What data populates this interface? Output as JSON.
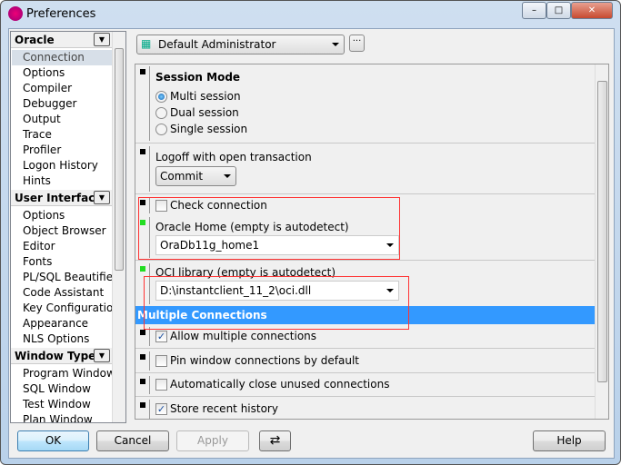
{
  "window": {
    "title": "Preferences",
    "minimize": "–",
    "maximize": "□",
    "close": "✕"
  },
  "sidebar": {
    "groups": [
      {
        "label": "Oracle",
        "items": [
          "Connection",
          "Options",
          "Compiler",
          "Debugger",
          "Output",
          "Trace",
          "Profiler",
          "Logon History",
          "Hints"
        ]
      },
      {
        "label": "User Interface",
        "items": [
          "Options",
          "Object Browser",
          "Editor",
          "Fonts",
          "PL/SQL Beautifier",
          "Code Assistant",
          "Key Configuration",
          "Appearance",
          "NLS Options"
        ]
      },
      {
        "label": "Window Types",
        "items": [
          "Program Window",
          "SQL Window",
          "Test Window",
          "Plan Window"
        ]
      }
    ],
    "selected": "Connection"
  },
  "profile": {
    "value": "Default Administrator",
    "more": "···"
  },
  "settings": {
    "session_mode": {
      "label": "Session Mode",
      "options": [
        {
          "label": "Multi session",
          "checked": true
        },
        {
          "label": "Dual session",
          "checked": false
        },
        {
          "label": "Single session",
          "checked": false
        }
      ]
    },
    "logoff": {
      "label": "Logoff with open transaction",
      "value": "Commit"
    },
    "check_connection": {
      "label": "Check connection",
      "checked": false
    },
    "oracle_home": {
      "label": "Oracle Home (empty is autodetect)",
      "value": "OraDb11g_home1"
    },
    "oci_library": {
      "label": "OCI library (empty is autodetect)",
      "value": "D:\\instantclient_11_2\\oci.dll"
    },
    "multiple_header": "Multiple Connections",
    "allow_multiple": {
      "label": "Allow multiple connections",
      "checked": true
    },
    "pin_window": {
      "label": "Pin window connections by default",
      "checked": false
    },
    "auto_close": {
      "label": "Automatically close unused connections",
      "checked": false
    },
    "store_history": {
      "label": "Store recent history",
      "checked": true
    }
  },
  "buttons": {
    "ok": "OK",
    "cancel": "Cancel",
    "apply": "Apply",
    "help": "Help"
  },
  "colors": {
    "section_header": "#3399ff",
    "marker_modified": "#22dd22",
    "highlight_box": "#ff3333"
  }
}
